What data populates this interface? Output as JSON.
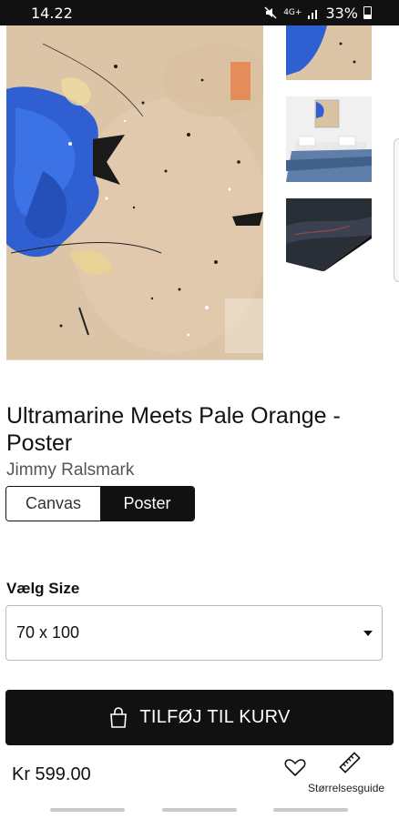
{
  "status_bar": {
    "time": "14.22",
    "network": "4G+",
    "battery": "33%",
    "icons": [
      "mute-icon",
      "data-arrows-icon",
      "signal-icon",
      "battery-icon"
    ]
  },
  "gallery": {
    "main_image": "abstract-painting-blue-orange",
    "thumbnails": [
      "painting-crop-thumbnail",
      "bedroom-mockup-thumbnail",
      "canvas-edge-thumbnail"
    ]
  },
  "product": {
    "title": "Ultramarine Meets Pale Orange - Poster",
    "artist": "Jimmy Ralsmark"
  },
  "format": {
    "options": [
      "Canvas",
      "Poster"
    ],
    "selected": "Poster"
  },
  "size": {
    "label": "Vælg Size",
    "selected": "70 x 100"
  },
  "cart": {
    "button_label": "TILFØJ TIL KURV"
  },
  "footer": {
    "price": "Kr 599.00",
    "size_guide": "Størrelsesguide"
  },
  "colors": {
    "accent": "#111111",
    "canvas_bg": "#ddc4a4",
    "paint_blue": "#2f5fd0"
  }
}
